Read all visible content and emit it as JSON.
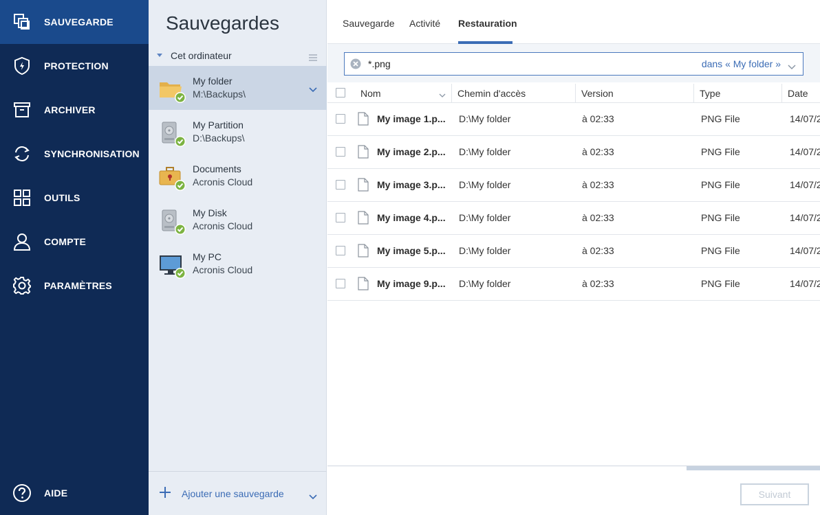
{
  "nav": {
    "items": [
      {
        "label": "SAUVEGARDE",
        "icon": "backup-copy-icon",
        "active": true
      },
      {
        "label": "PROTECTION",
        "icon": "shield-icon"
      },
      {
        "label": "ARCHIVER",
        "icon": "archive-box-icon"
      },
      {
        "label": "SYNCHRONISATION",
        "icon": "sync-icon"
      },
      {
        "label": "OUTILS",
        "icon": "grid-icon"
      },
      {
        "label": "COMPTE",
        "icon": "user-icon"
      },
      {
        "label": "PARAMÈTRES",
        "icon": "gear-icon"
      }
    ],
    "help_label": "AIDE",
    "colors": {
      "background": "#0f2a55",
      "active": "#1a4a8c"
    }
  },
  "backups": {
    "title": "Sauvegardes",
    "group_label": "Cet ordinateur",
    "items": [
      {
        "name": "My folder",
        "location": "M:\\Backups\\",
        "icon": "folder-icon",
        "selected": true
      },
      {
        "name": "My Partition",
        "location": "D:\\Backups\\",
        "icon": "disk-icon"
      },
      {
        "name": "Documents",
        "location": "Acronis Cloud",
        "icon": "briefcase-icon"
      },
      {
        "name": "My Disk",
        "location": "Acronis Cloud",
        "icon": "disk-icon"
      },
      {
        "name": "My PC",
        "location": "Acronis Cloud",
        "icon": "monitor-icon"
      }
    ],
    "add_label": "Ajouter une sauvegarde"
  },
  "tabs": [
    {
      "label": "Sauvegarde"
    },
    {
      "label": "Activité"
    },
    {
      "label": "Restauration",
      "active": true
    }
  ],
  "search": {
    "value": "*.png",
    "scope": "dans « My folder »"
  },
  "table": {
    "columns": [
      "Nom",
      "Chemin d'accès",
      "Version",
      "Type",
      "Date"
    ],
    "rows": [
      {
        "name": "My image 1.p...",
        "path": "D:\\My folder",
        "version": "à 02:33",
        "type": "PNG File",
        "date": "14/07/2"
      },
      {
        "name": "My image 2.p...",
        "path": "D:\\My folder",
        "version": "à 02:33",
        "type": "PNG File",
        "date": "14/07/2"
      },
      {
        "name": "My image 3.p...",
        "path": "D:\\My folder",
        "version": "à 02:33",
        "type": "PNG File",
        "date": "14/07/2"
      },
      {
        "name": "My image 4.p...",
        "path": "D:\\My folder",
        "version": "à 02:33",
        "type": "PNG File",
        "date": "14/07/2"
      },
      {
        "name": "My image 5.p...",
        "path": "D:\\My folder",
        "version": "à 02:33",
        "type": "PNG File",
        "date": "14/07/2"
      },
      {
        "name": "My image 9.p...",
        "path": "D:\\My folder",
        "version": "à 02:33",
        "type": "PNG File",
        "date": "14/07/2"
      }
    ]
  },
  "footer": {
    "next_label": "Suivant"
  },
  "accent": "#3b6cb5"
}
